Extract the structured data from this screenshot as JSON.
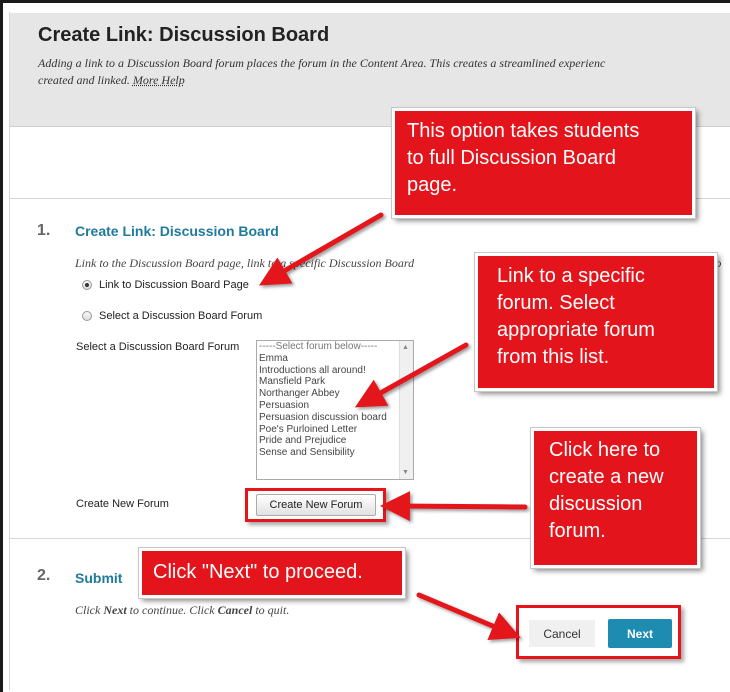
{
  "header": {
    "title": "Create Link: Discussion Board",
    "description_line1": "Adding a link to a Discussion Board forum places the forum in the Content Area. This creates a streamlined experienc",
    "description_line2": "created and linked.",
    "more_help": "More Help"
  },
  "section1": {
    "number": "1.",
    "title": "Create Link: Discussion Board",
    "instruction": "Link to the Discussion Board page, link to a specific Discussion Board",
    "instruction_tail": "fo",
    "radio_page": "Link to Discussion Board Page",
    "radio_forum": "Select a Discussion Board Forum",
    "select_label": "Select a Discussion Board Forum",
    "forum_options": [
      "-----Select forum below-----",
      "Emma",
      "Introductions all around!",
      "Mansfield Park",
      "Northanger Abbey",
      "Persuasion",
      "Persuasion discussion board",
      "Poe's Purloined Letter",
      "Pride and Prejudice",
      "Sense and Sensibility"
    ],
    "create_forum_label": "Create New Forum",
    "create_forum_button": "Create New Forum"
  },
  "section2": {
    "number": "2.",
    "title": "Submit",
    "instruction_pre": "Click ",
    "instruction_next": "Next",
    "instruction_mid": " to continue. Click ",
    "instruction_cancel": "Cancel",
    "instruction_post": " to quit."
  },
  "buttons": {
    "cancel": "Cancel",
    "next": "Next"
  },
  "callouts": {
    "full_page": [
      "This option takes students",
      "to full Discussion Board",
      "page."
    ],
    "specific_forum": [
      "Link to a specific",
      "forum. Select",
      "appropriate forum",
      "from this list."
    ],
    "new_forum": [
      "Click here to",
      "create a new",
      "discussion",
      "forum."
    ],
    "next": "Click \"Next\" to proceed."
  },
  "colors": {
    "callout_red": "#e3141b",
    "link_blue": "#1f7a9c",
    "next_button": "#1e8bb0"
  },
  "icons": {
    "radio_selected": "radio-selected-icon",
    "radio_unselected": "radio-unselected-icon",
    "scroll_up": "scroll-up-icon",
    "scroll_down": "scroll-down-icon"
  }
}
